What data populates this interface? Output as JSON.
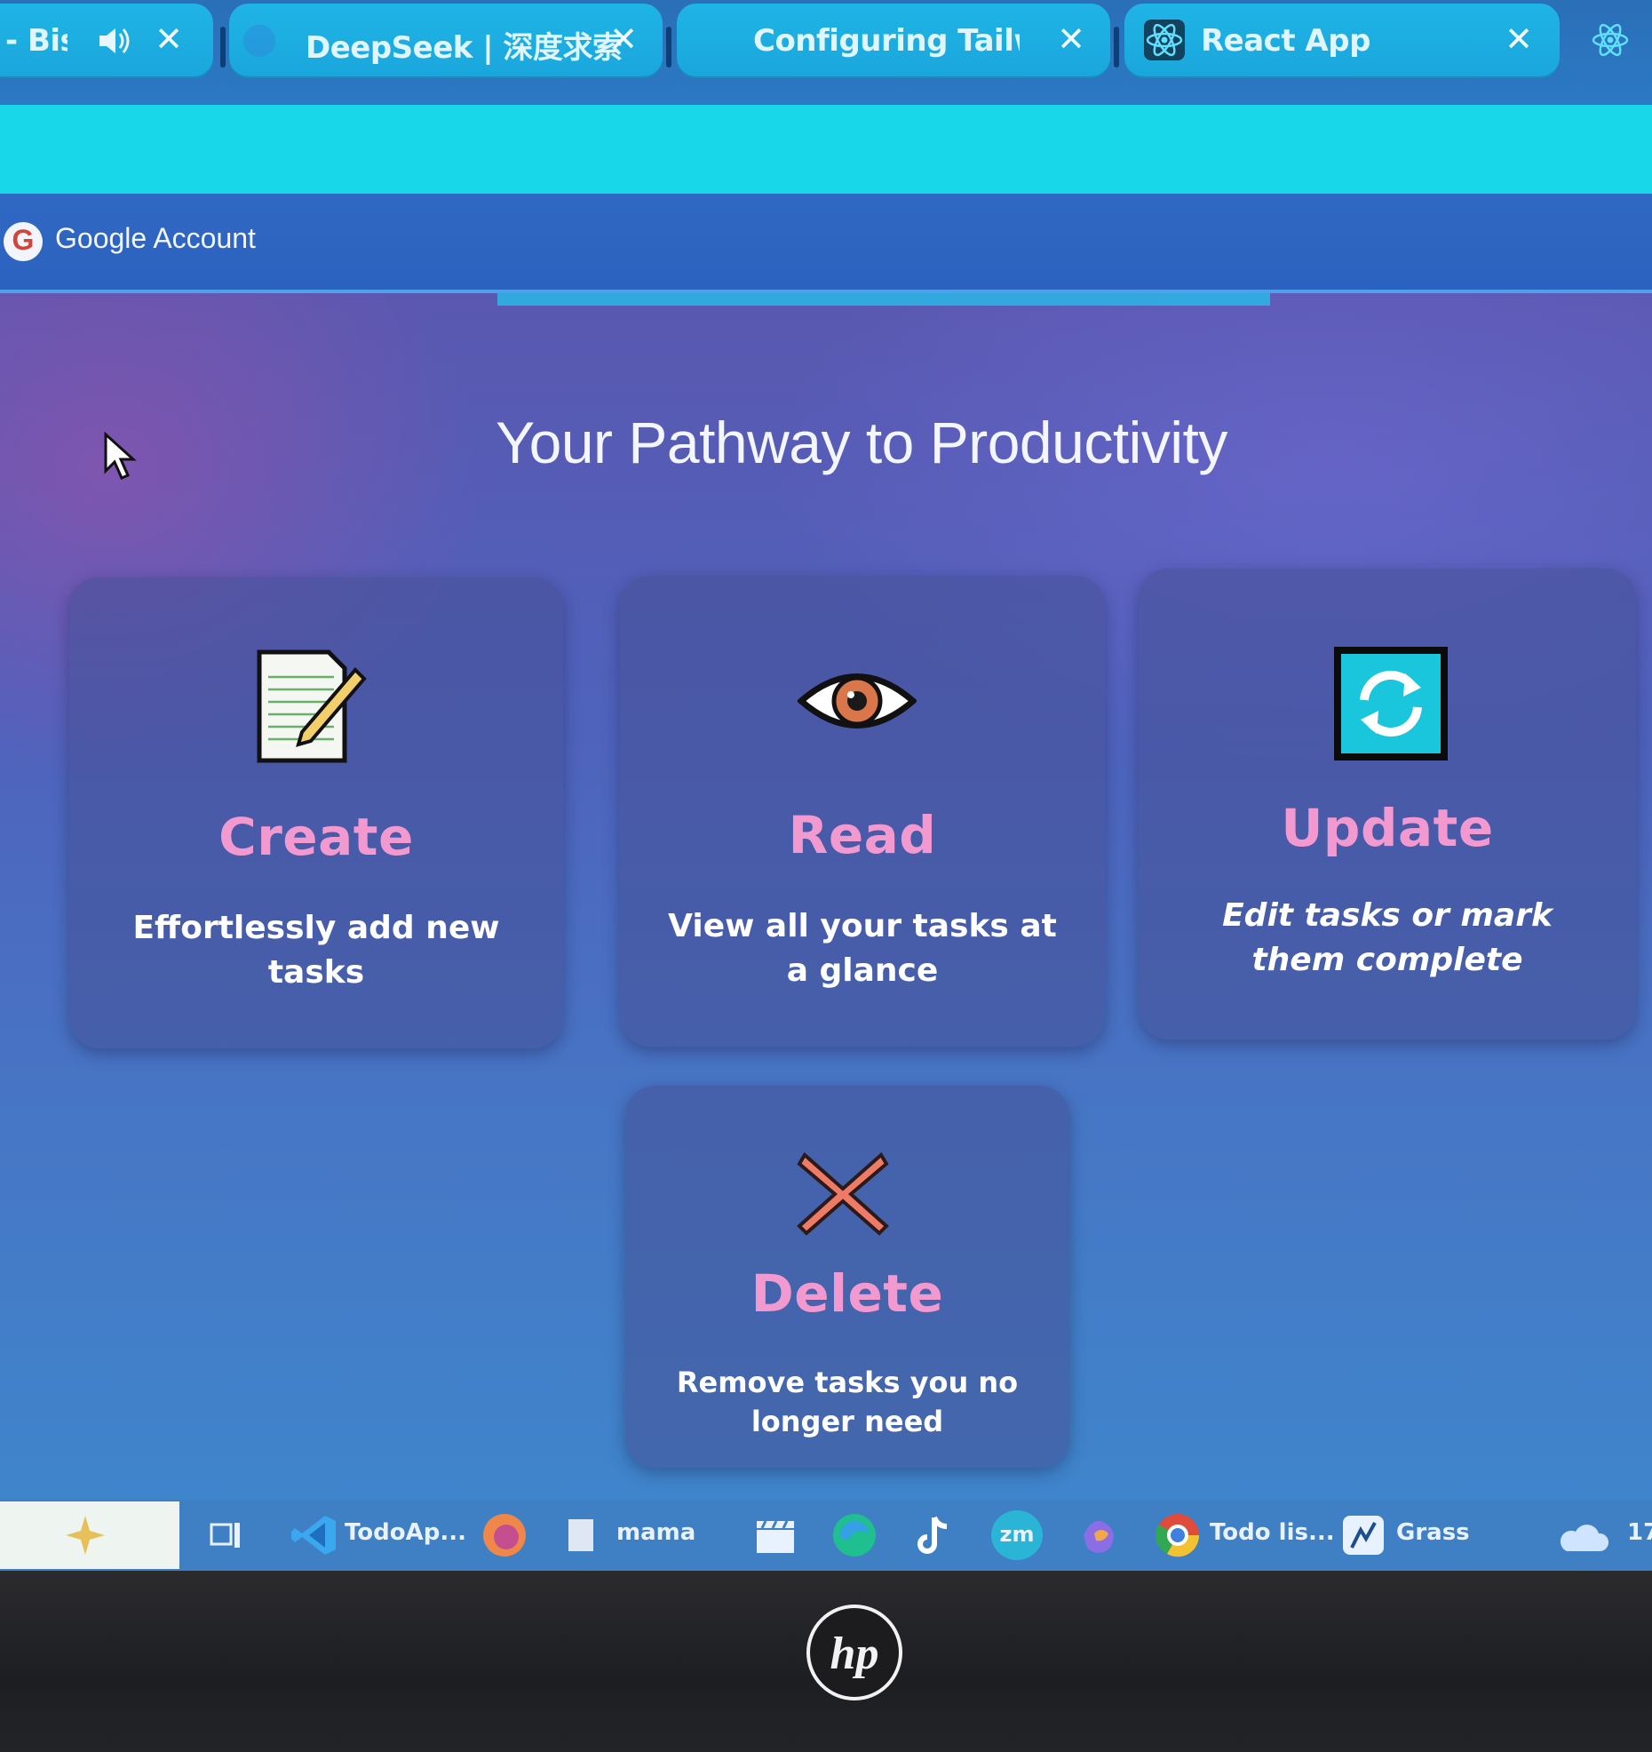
{
  "browser": {
    "tabs": [
      {
        "label": "- Bis",
        "audio_icon": "speaker-icon",
        "close": "✕"
      },
      {
        "label": "DeepSeek | 深度求索",
        "close": "✕"
      },
      {
        "label": "Configuring Tailwind",
        "close": "✕"
      },
      {
        "label": "React App",
        "favicon": "react-logo-icon",
        "close": "✕"
      }
    ],
    "bookmark": {
      "icon": "google-g-icon",
      "icon_letter": "G",
      "label": "Google Account"
    }
  },
  "page": {
    "title": "Your Pathway to Productivity",
    "cards": [
      {
        "title": "Create",
        "description_line1": "Effortlessly add new",
        "description_line2": "tasks",
        "icon": "notepad-pencil-icon"
      },
      {
        "title": "Read",
        "description_line1": "View all your tasks at",
        "description_line2": "a glance",
        "icon": "eye-icon"
      },
      {
        "title": "Update",
        "description_line1": "Edit tasks or mark",
        "description_line2": "them complete",
        "icon": "refresh-icon"
      },
      {
        "title": "Delete",
        "description_line1": "Remove tasks you no",
        "description_line2": "longer need",
        "icon": "cross-mark-icon"
      }
    ]
  },
  "taskbar": {
    "items": [
      {
        "label": "",
        "icon": "task-view-icon"
      },
      {
        "label": "TodoAp...",
        "icon": "vscode-icon"
      },
      {
        "label": "",
        "icon": "firefox-icon"
      },
      {
        "label": "mama",
        "icon": "notepad-icon"
      },
      {
        "label": "",
        "icon": "clapperboard-icon"
      },
      {
        "label": "",
        "icon": "edge-icon"
      },
      {
        "label": "",
        "icon": "tiktok-icon"
      },
      {
        "label": "zm",
        "icon": "zoom-icon"
      },
      {
        "label": "",
        "icon": "copilot-icon"
      },
      {
        "label": "Todo lis...",
        "icon": "chrome-icon"
      },
      {
        "label": "Grass",
        "icon": "grass-app-icon"
      }
    ],
    "tray_text": "17"
  },
  "device": {
    "logo": "hp"
  },
  "colors": {
    "accent_cyan": "#18d7e8",
    "tab_blue": "#1fb4e6",
    "card_title_pink": "#f29ad0"
  }
}
